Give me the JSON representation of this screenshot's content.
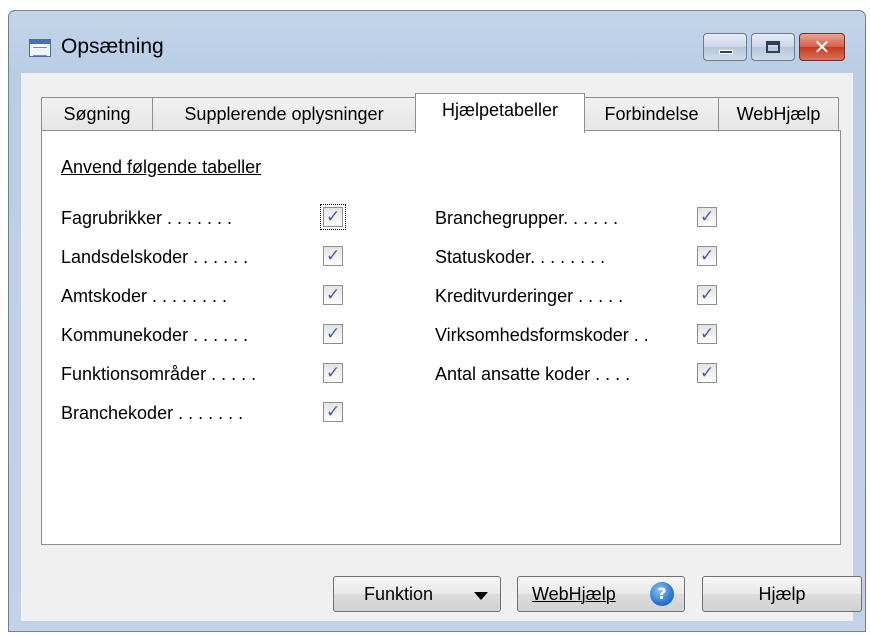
{
  "window": {
    "title": "Opsætning"
  },
  "tabs": [
    {
      "label": "Søgning"
    },
    {
      "label": "Supplerende oplysninger"
    },
    {
      "label": "Hjælpetabeller"
    },
    {
      "label": "Forbindelse"
    },
    {
      "label": "WebHjælp"
    }
  ],
  "active_tab": "Hjælpetabeller",
  "panel": {
    "group_label": "Anvend følgende tabeller",
    "left_column": [
      {
        "label": "Fagrubrikker . . . . . . .",
        "checked": true
      },
      {
        "label": "Landsdelskoder . . . . . .",
        "checked": true
      },
      {
        "label": "Amtskoder . . . . . . . .",
        "checked": true
      },
      {
        "label": "Kommunekoder . . . . . .",
        "checked": true
      },
      {
        "label": "Funktionsområder . . . . .",
        "checked": true
      },
      {
        "label": "Branchekoder . . . . . . .",
        "checked": true
      }
    ],
    "right_column": [
      {
        "label": "Branchegrupper. . . . . .",
        "checked": true
      },
      {
        "label": "Statuskoder. . . . . . . .",
        "checked": true
      },
      {
        "label": "Kreditvurderinger . . . . .",
        "checked": true
      },
      {
        "label": "Virksomhedsformskoder . .",
        "checked": true
      },
      {
        "label": "Antal ansatte koder . . . .",
        "checked": true
      }
    ]
  },
  "buttons": {
    "funktion": "Funktion",
    "webhjaelp": "WebHjælp",
    "hjaelp": "Hjælp"
  },
  "icons": {
    "app": "table-icon",
    "help": "question-icon"
  }
}
